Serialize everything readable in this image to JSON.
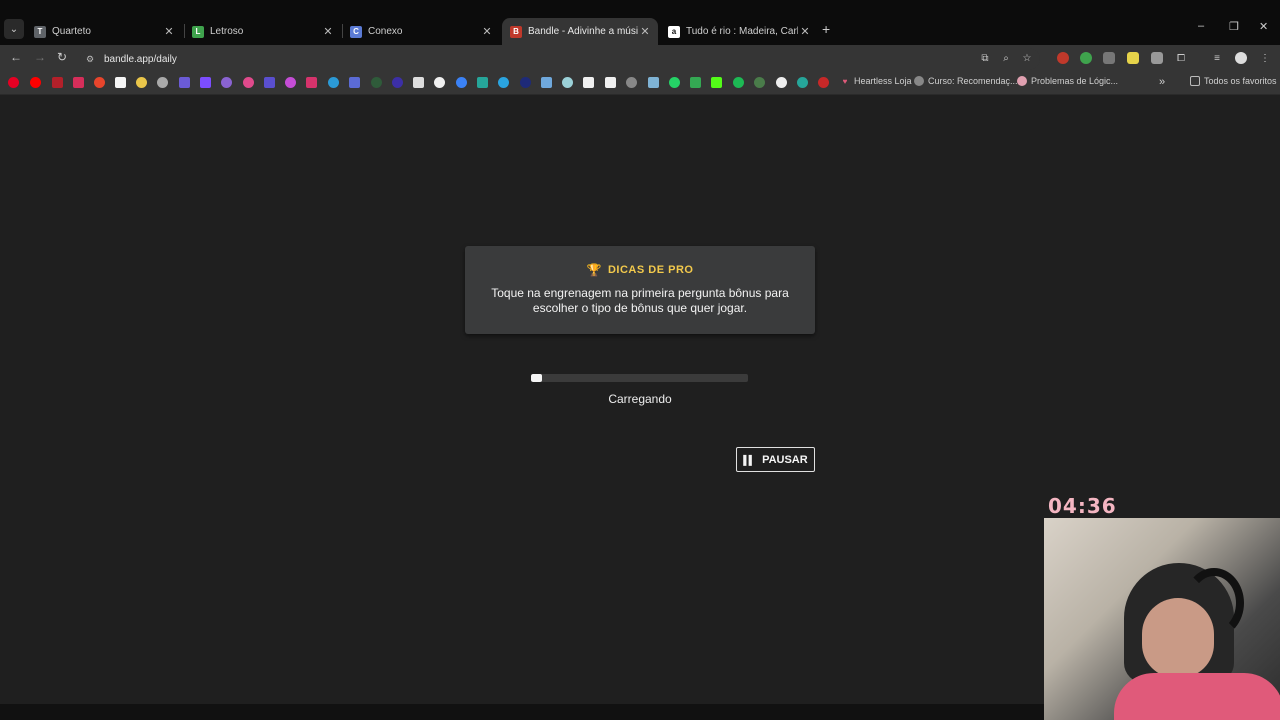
{
  "browser": {
    "tabs": [
      {
        "title": "Quarteto",
        "favicon": "T",
        "favicon_color": "#5f6368",
        "active": false
      },
      {
        "title": "Letroso",
        "favicon": "L",
        "favicon_color": "#3fa34d",
        "active": false
      },
      {
        "title": "Conexo",
        "favicon": "C",
        "favicon_color": "#5b7bd5",
        "active": false
      },
      {
        "title": "Bandle - Adivinhe a música, um",
        "favicon": "B",
        "favicon_color": "#c0392b",
        "active": true
      },
      {
        "title": "Tudo é rio : Madeira, Carla: Am",
        "favicon": "a",
        "favicon_color": "#ffffff",
        "active": false
      }
    ],
    "new_tab": "+",
    "window_controls": {
      "minimize": "–",
      "maximize": "❐",
      "close": "✕"
    },
    "url": "bandle.app/daily",
    "bookmarks": [
      {
        "label": "Heartless Loja"
      },
      {
        "label": "Curso: Recomendaç..."
      },
      {
        "label": "Problemas de Lógic..."
      },
      {
        "label": "Todos os favoritos"
      }
    ],
    "bookmarks_overflow": "»"
  },
  "page": {
    "tip": {
      "title": "DICAS DE PRO",
      "text": "Toque na engrenagem na primeira pergunta bônus para escolher o tipo de bônus que quer jogar."
    },
    "progress": 0.05,
    "loading_label": "Carregando",
    "pause_label": "PAUSAR"
  },
  "overlay": {
    "timer": "04:36"
  },
  "colors": {
    "accent_gold": "#f2c94c",
    "timer_pink": "#f4b6c2",
    "page_bg": "#1f1f1f"
  }
}
